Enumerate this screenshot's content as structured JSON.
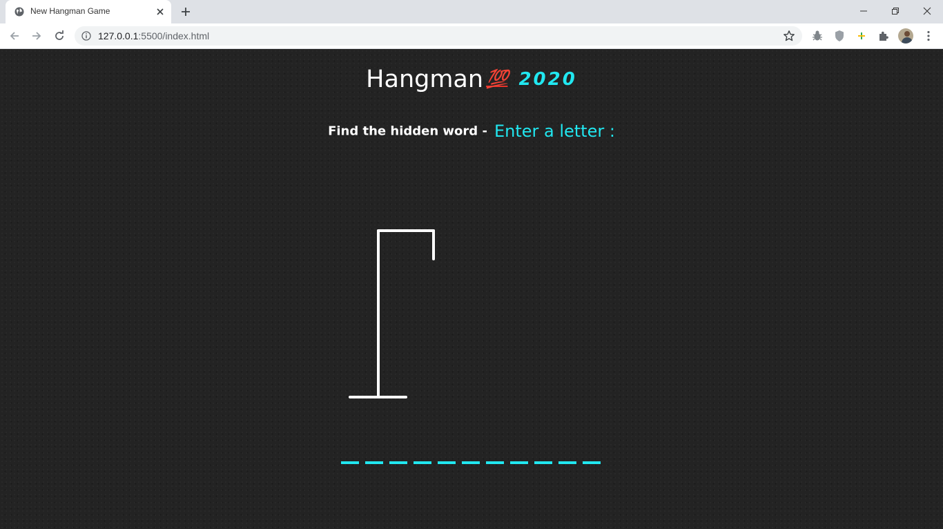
{
  "browser": {
    "tab": {
      "title": "New Hangman Game"
    },
    "address": {
      "host": "127.0.0.1",
      "rest": ":5500/index.html"
    }
  },
  "game": {
    "title": "Hangman",
    "emoji": "💯",
    "year": "2020",
    "prompt_label": "Find the hidden word -",
    "prompt_action": "Enter a letter :",
    "blank_count": 11,
    "accent_color": "#21e7f0"
  }
}
